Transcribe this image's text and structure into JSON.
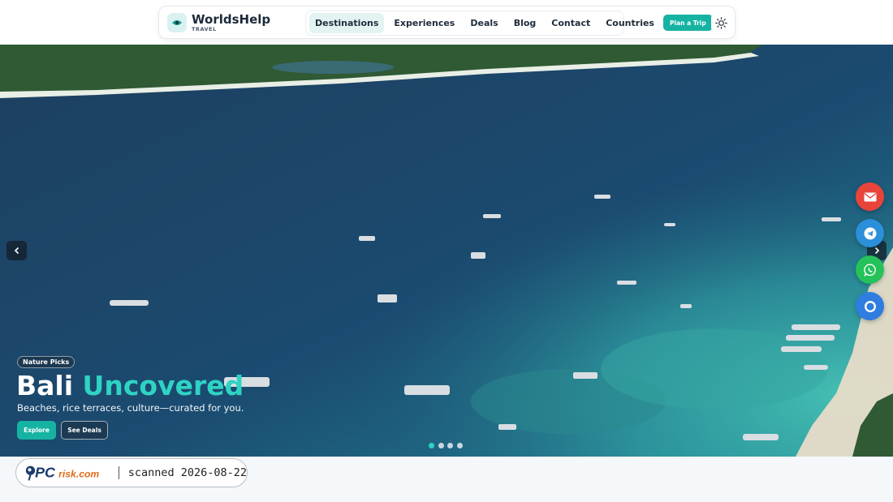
{
  "brand": {
    "name": "WorldsHelp",
    "tagline": "TRAVEL"
  },
  "nav": {
    "items": [
      {
        "label": "Destinations"
      },
      {
        "label": "Experiences"
      },
      {
        "label": "Deals"
      },
      {
        "label": "Blog"
      },
      {
        "label": "Contact"
      },
      {
        "label": "Countries"
      }
    ],
    "active_index": 0
  },
  "header": {
    "cta_label": "Plan a Trip",
    "theme_icon": "sun-icon"
  },
  "hero": {
    "badge": "Nature Picks",
    "title_main": "Bali",
    "title_accent": "Uncovered",
    "subtitle": "Beaches, rice terraces, culture—curated for you.",
    "primary_label": "Explore",
    "secondary_label": "See Deals",
    "slide_count": 4,
    "active_slide": 1
  },
  "floating": [
    {
      "icon": "mail-icon",
      "color": "#e8443a"
    },
    {
      "icon": "telegram-icon",
      "color": "#2b8fd9"
    },
    {
      "icon": "whatsapp-icon",
      "color": "#25c15a"
    },
    {
      "icon": "chat-icon",
      "color": "#2f7de0"
    }
  ],
  "watermark": {
    "logo_text": "PCrisk.com",
    "scan_text": "scanned 2026-08-22"
  },
  "colors": {
    "accent": "#16b3a3",
    "title_accent": "#2fd3c3"
  }
}
